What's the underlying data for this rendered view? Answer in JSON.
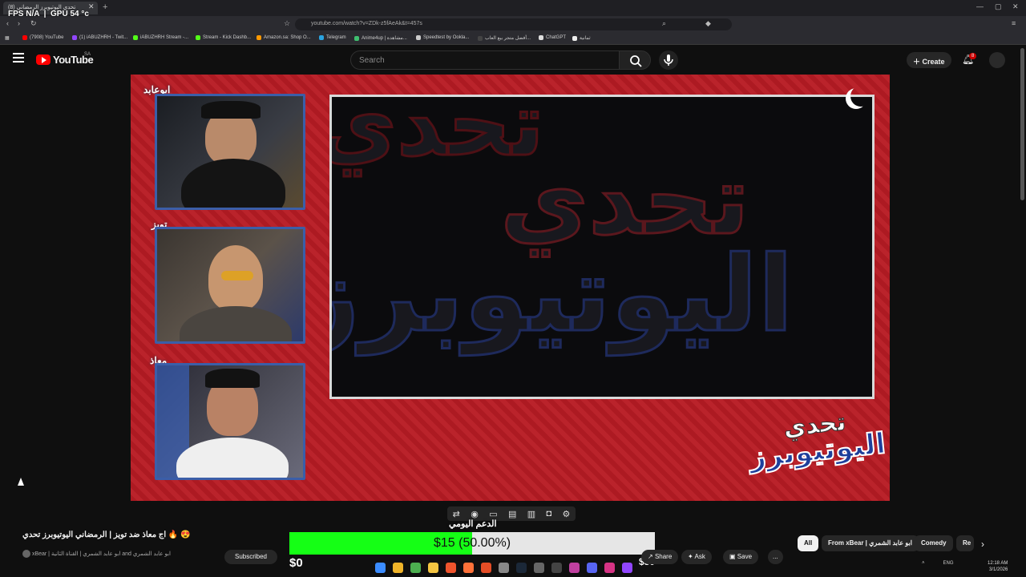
{
  "browser": {
    "tab_title": "(8) تحدي اليوتيوبرز الرمضاني",
    "url": "youtube.com/watch?v=ZDk-z5fAeAk&t=457s",
    "new_tab": "+",
    "close": "✕",
    "bookmarks": [
      {
        "label": "(7908) YouTube",
        "color": "#ff0000"
      },
      {
        "label": "(1) iABUZHRH - Twit...",
        "color": "#9146ff"
      },
      {
        "label": "iABUZHRH Stream -...",
        "color": "#53fc18"
      },
      {
        "label": "Stream - Kick Dashb...",
        "color": "#53fc18"
      },
      {
        "label": "Amazon.sa: Shop O...",
        "color": "#ff9900"
      },
      {
        "label": "Telegram",
        "color": "#2aa3df"
      },
      {
        "label": "Anime4up | مشاهدة...",
        "color": "#3fbf6f"
      },
      {
        "label": "Speedtest by Ookla...",
        "color": "#cccccc"
      },
      {
        "label": "أفضل متجر بيع العاب...",
        "color": "#444444"
      },
      {
        "label": "ChatGPT",
        "color": "#dddddd"
      },
      {
        "label": "ثمانية",
        "color": "#eeeeee"
      }
    ]
  },
  "overlay": {
    "fps_label": "FPS",
    "fps_value": "N/A",
    "gpu_label": "GPU",
    "gpu_value": "54 °c"
  },
  "header": {
    "logo_text": "YouTube",
    "country": "SA",
    "search_placeholder": "Search",
    "create_label": "Create",
    "notifications_count": "8"
  },
  "player": {
    "cam_labels": [
      "ابوعابد",
      "تويز",
      "معاذ"
    ],
    "main_text_lines": [
      "تحدي",
      "اليوتيوبرز"
    ],
    "logo_line1": "تحدي",
    "logo_line2": "اليوتيوبرز"
  },
  "donation": {
    "label": "الدعم اليومي",
    "text": "$15 (50.00%)",
    "progress": 0.5,
    "min": "$0",
    "max": "$30"
  },
  "video": {
    "title": "😍 🔥 اج معاذ ضد تويز | الرمضاني اليوتيوبرز تحدي",
    "channel": "xBear | ابو عابد الشمري | القناة الثانية and ابو عابد الشمري",
    "subscribe_label": "Subscribed",
    "actions": [
      "Share",
      "Ask",
      "Save"
    ],
    "more": "..."
  },
  "chips": [
    "All",
    "From xBear | ابو عابد الشمري",
    "Comedy",
    "Re"
  ],
  "taskbar": {
    "lang": "ENG",
    "time": "12:18 AM",
    "date": "3/1/2026"
  }
}
